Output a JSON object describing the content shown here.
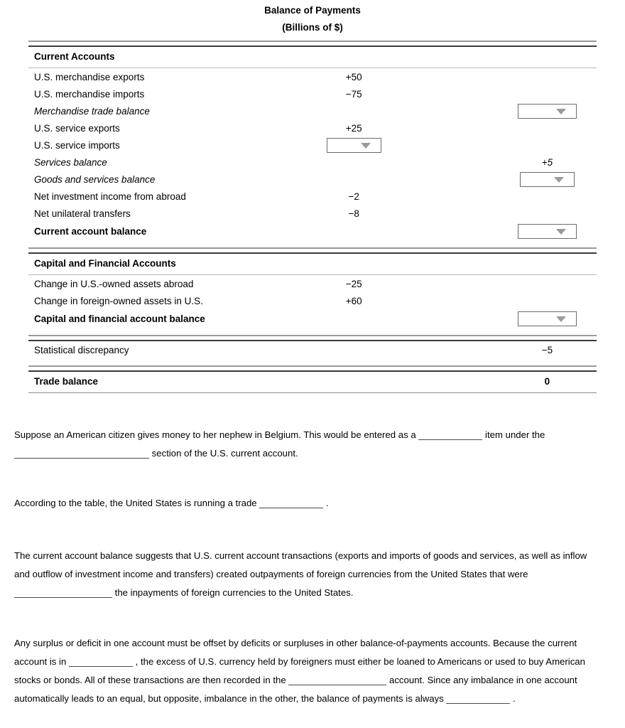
{
  "title": {
    "line1": "Balance of Payments",
    "line2": "(Billions of $)"
  },
  "table": {
    "sections": [
      {
        "heading": "Current Accounts",
        "rows": [
          {
            "label": "U.S. merchandise exports",
            "style": "normal",
            "value_col1": "+50",
            "value_col3": "",
            "dropdown": "none"
          },
          {
            "label": "U.S. merchandise imports",
            "style": "normal",
            "value_col1": "−75",
            "value_col3": "",
            "dropdown": "none"
          },
          {
            "label": "Merchandise trade balance",
            "style": "italic",
            "value_col1": "",
            "value_col3": "",
            "dropdown": "col3"
          },
          {
            "label": "U.S. service exports",
            "style": "normal",
            "value_col1": "+25",
            "value_col3": "",
            "dropdown": "none"
          },
          {
            "label": "U.S. service imports",
            "style": "normal",
            "value_col1": "",
            "value_col3": "",
            "dropdown": "col1"
          },
          {
            "label": "Services balance",
            "style": "italic",
            "value_col1": "",
            "value_col3": "+5",
            "dropdown": "none"
          },
          {
            "label": "Goods and services balance",
            "style": "italic",
            "value_col1": "",
            "value_col3": "",
            "dropdown": "col3"
          },
          {
            "label": "Net investment income from abroad",
            "style": "normal",
            "value_col1": "−2",
            "value_col3": "",
            "dropdown": "none"
          },
          {
            "label": "Net unilateral transfers",
            "style": "normal",
            "value_col1": "−8",
            "value_col3": "",
            "dropdown": "none"
          },
          {
            "label": "Current account balance",
            "style": "bold",
            "value_col1": "",
            "value_col3": "",
            "dropdown": "col3"
          }
        ]
      },
      {
        "heading": "Capital and Financial Accounts",
        "rows": [
          {
            "label": "Change in U.S.-owned assets abroad",
            "style": "normal",
            "value_col1": "−25",
            "value_col3": "",
            "dropdown": "none"
          },
          {
            "label": "Change in foreign-owned assets in U.S.",
            "style": "normal",
            "value_col1": "+60",
            "value_col3": "",
            "dropdown": "none"
          },
          {
            "label": "Capital and financial account balance",
            "style": "bold",
            "value_col1": "",
            "value_col3": "",
            "dropdown": "col3"
          }
        ]
      }
    ],
    "discrepancy": {
      "label": "Statistical discrepancy",
      "value": "−5"
    },
    "trade_balance": {
      "label": "Trade balance",
      "value": "0"
    }
  },
  "questions": {
    "q1": {
      "part1": "Suppose an American citizen gives money to her nephew in Belgium. This would be entered as a",
      "part2": "item",
      "part3": "under the",
      "part4": "section of the U.S. current account."
    },
    "q2": {
      "part1": "According to the table, the United States is running a trade",
      "part2": "."
    },
    "q3": {
      "part1": "The current account balance suggests that U.S. current account transactions (exports and imports of goods and services, as well as inflow and outflow of investment income and transfers) created outpayments of foreign currencies from the United States that were",
      "part2": "the inpayments of foreign currencies to the United States."
    },
    "q4": {
      "part1": "Any surplus or deficit in one account must be offset by deficits or surpluses in other balance-of-payments accounts. Because the current account is in",
      "part2": ", the excess of U.S. currency held by foreigners must either be loaned to Americans or used to buy American stocks or bonds. All of these transactions are then recorded in the",
      "part3": "account. Since any imbalance in one account automatically leads to an equal, but opposite, imbalance in the other, the balance of payments is always",
      "part4": "."
    }
  },
  "colors": {
    "rule_light": "#9a9a9a",
    "rule_dark": "#3a3a3a",
    "dropdown_border": "#6b6b6b",
    "dropdown_arrow": "#9a9a9a"
  }
}
